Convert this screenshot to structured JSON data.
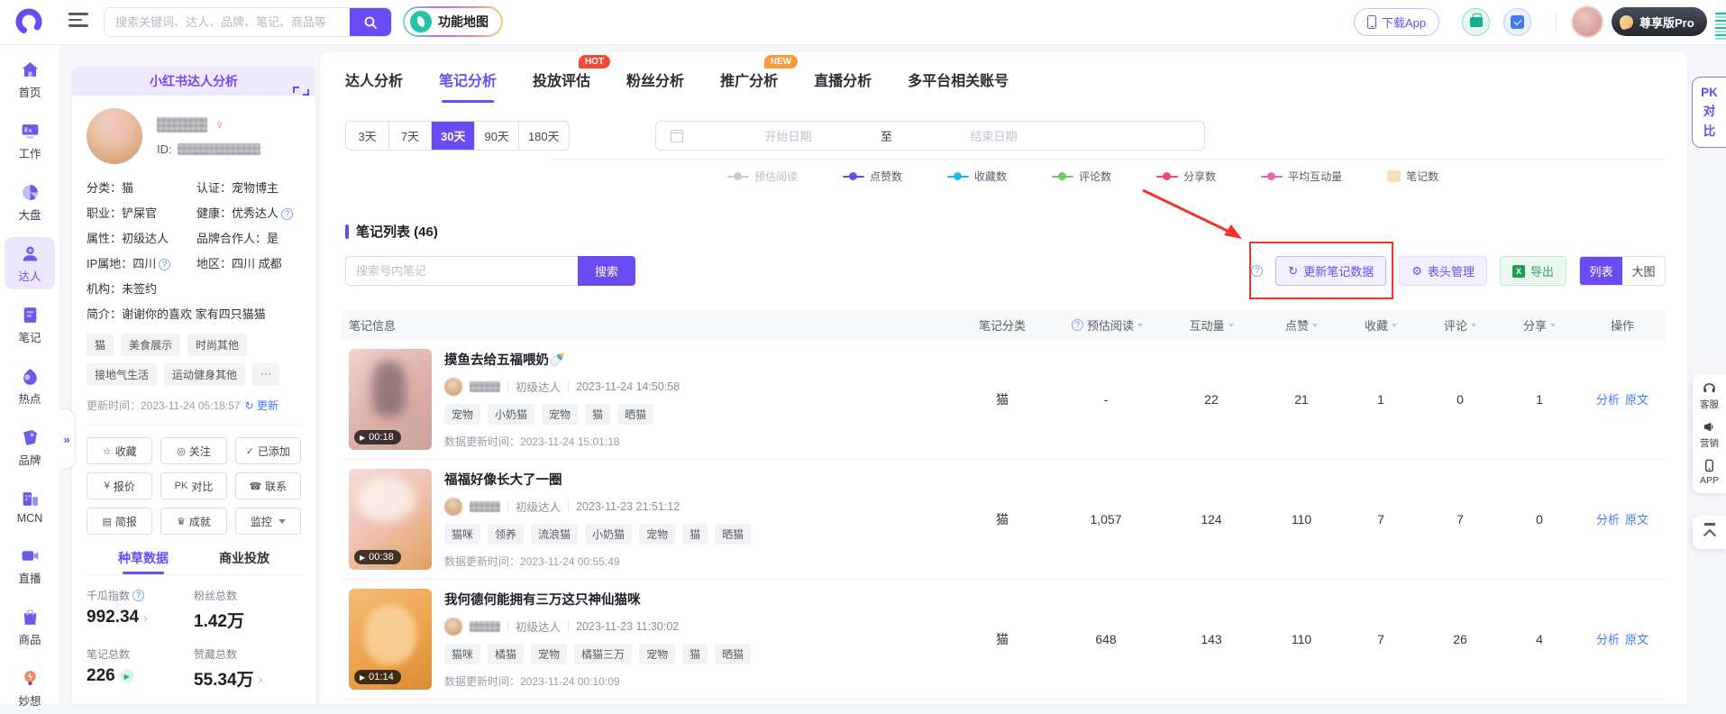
{
  "icons": {
    "help": "?",
    "refresh": "↻",
    "gear": "⚙",
    "play": "▶",
    "collapse": "»"
  },
  "topbar": {
    "search_placeholder": "搜索关键词、达人、品牌、笔记、商品等",
    "feature_map_label": "功能地图",
    "download_app_label": "下载App",
    "vip_label": "尊享版Pro"
  },
  "sidebar": {
    "items": [
      {
        "label": "首页"
      },
      {
        "label": "工作"
      },
      {
        "label": "大盘"
      },
      {
        "label": "达人"
      },
      {
        "label": "笔记"
      },
      {
        "label": "热点"
      },
      {
        "label": "品牌"
      },
      {
        "label": "MCN"
      },
      {
        "label": "直播"
      },
      {
        "label": "商品"
      },
      {
        "label": "妙想"
      }
    ]
  },
  "profile": {
    "panel_title": "小红书达人分析",
    "gender": "♀",
    "id_label": "ID:",
    "info": [
      {
        "l": "分类：",
        "v": "猫"
      },
      {
        "l": "认证：",
        "v": "宠物博主"
      },
      {
        "l": "职业：",
        "v": "铲屎官"
      },
      {
        "l": "健康：",
        "v": "优秀达人"
      },
      {
        "l": "属性：",
        "v": "初级达人"
      },
      {
        "l": "品牌合作人：",
        "v": "是"
      },
      {
        "l": "IP属地：",
        "v": "四川"
      },
      {
        "l": "地区：",
        "v": "四川 成都"
      },
      {
        "l": "机构：",
        "v": "未签约"
      },
      {
        "l": "简介：",
        "v": "谢谢你的喜欢 家有四只猫猫"
      }
    ],
    "tags": [
      "猫",
      "美食展示",
      "时尚其他",
      "接地气生活",
      "运动健身其他",
      "···"
    ],
    "update_time": "更新时间：2023-11-24 05:18:57",
    "update_link": "更新",
    "buttons": [
      {
        "icon": "☆",
        "label": "收藏"
      },
      {
        "icon": "◎",
        "label": "关注"
      },
      {
        "icon": "✓",
        "label": "已添加"
      },
      {
        "icon": "¥",
        "label": "报价"
      },
      {
        "icon": "PK",
        "label": "对比"
      },
      {
        "icon": "☎",
        "label": "联系"
      },
      {
        "icon": "▤",
        "label": "简报"
      },
      {
        "icon": "♛",
        "label": "成就"
      },
      {
        "icon": "",
        "label": "监控"
      }
    ],
    "tabs": [
      {
        "label": "种草数据"
      },
      {
        "label": "商业投放"
      }
    ],
    "stats": [
      {
        "label": "千瓜指数",
        "value": "992.34",
        "arrow": "›"
      },
      {
        "label": "粉丝总数",
        "value": "1.42万",
        "arrow": ""
      },
      {
        "label": "笔记总数",
        "value": "226",
        "arrow": ""
      },
      {
        "label": "赞藏总数",
        "value": "55.34万",
        "arrow": "›"
      }
    ]
  },
  "main": {
    "tabs": [
      {
        "label": "达人分析"
      },
      {
        "label": "笔记分析"
      },
      {
        "label": "投放评估",
        "badge": "HOT"
      },
      {
        "label": "粉丝分析"
      },
      {
        "label": "推广分析",
        "badge": "NEW"
      },
      {
        "label": "直播分析"
      },
      {
        "label": "多平台相关账号"
      }
    ],
    "date_ranges": [
      {
        "label": "3天"
      },
      {
        "label": "7天"
      },
      {
        "label": "30天"
      },
      {
        "label": "90天"
      },
      {
        "label": "180天"
      }
    ],
    "date_picker": {
      "start": "开始日期",
      "to": "至",
      "end": "结束日期"
    },
    "legend": [
      {
        "label": "预估阅读",
        "color": "#c8cad2"
      },
      {
        "label": "点赞数",
        "color": "#6a4bf5"
      },
      {
        "label": "收藏数",
        "color": "#1fb9ec"
      },
      {
        "label": "评论数",
        "color": "#6ece62"
      },
      {
        "label": "分享数",
        "color": "#f0496b"
      },
      {
        "label": "平均互动量",
        "color": "#f464ae"
      },
      {
        "label": "笔记数",
        "color": "#f7deb4"
      }
    ],
    "list_title": "笔记列表 (46)",
    "note_search_placeholder": "搜索号内笔记",
    "search_button": "搜索",
    "refresh_button": "更新笔记数据",
    "header_manage_button": "表头管理",
    "export_button": "导出",
    "view_toggle": [
      {
        "label": "列表"
      },
      {
        "label": "大图"
      }
    ]
  },
  "table": {
    "headers": [
      "笔记信息",
      "笔记分类",
      "预估阅读",
      "互动量",
      "点赞",
      "收藏",
      "评论",
      "分享",
      "操作"
    ],
    "rows": [
      {
        "title": "摸鱼去给五福喂奶🍼",
        "level": "初级达人",
        "date": "2023-11-24 14:50:58",
        "tags": [
          "宠物",
          "小奶猫",
          "宠物",
          "猫",
          "晒猫"
        ],
        "updated": "数据更新时间：2023-11-24 15:01:18",
        "duration": "00:18",
        "category": "猫",
        "est_read": "-",
        "interactions": "22",
        "likes": "21",
        "collects": "1",
        "comments": "0",
        "shares": "1",
        "action1": "分析",
        "action2": "原文"
      },
      {
        "title": "福福好像长大了一圈",
        "level": "初级达人",
        "date": "2023-11-23 21:51:12",
        "tags": [
          "猫咪",
          "领养",
          "流浪猫",
          "小奶猫",
          "宠物",
          "猫",
          "晒猫"
        ],
        "updated": "数据更新时间：2023-11-24 00:55:49",
        "duration": "00:38",
        "category": "猫",
        "est_read": "1,057",
        "interactions": "124",
        "likes": "110",
        "collects": "7",
        "comments": "7",
        "shares": "0",
        "action1": "分析",
        "action2": "原文"
      },
      {
        "title": "我何德何能拥有三万这只神仙猫咪",
        "level": "初级达人",
        "date": "2023-11-23 11:30:02",
        "tags": [
          "猫咪",
          "橘猫",
          "宠物",
          "橘猫三万",
          "宠物",
          "猫",
          "晒猫"
        ],
        "updated": "数据更新时间：2023-11-24 00:10:09",
        "duration": "01:14",
        "category": "猫",
        "est_read": "648",
        "interactions": "143",
        "likes": "110",
        "collects": "7",
        "comments": "26",
        "shares": "4",
        "action1": "分析",
        "action2": "原文"
      }
    ]
  },
  "floating": {
    "pk_lines": [
      "PK",
      "对",
      "比"
    ],
    "tools": [
      "客服",
      "营销",
      "APP"
    ]
  }
}
